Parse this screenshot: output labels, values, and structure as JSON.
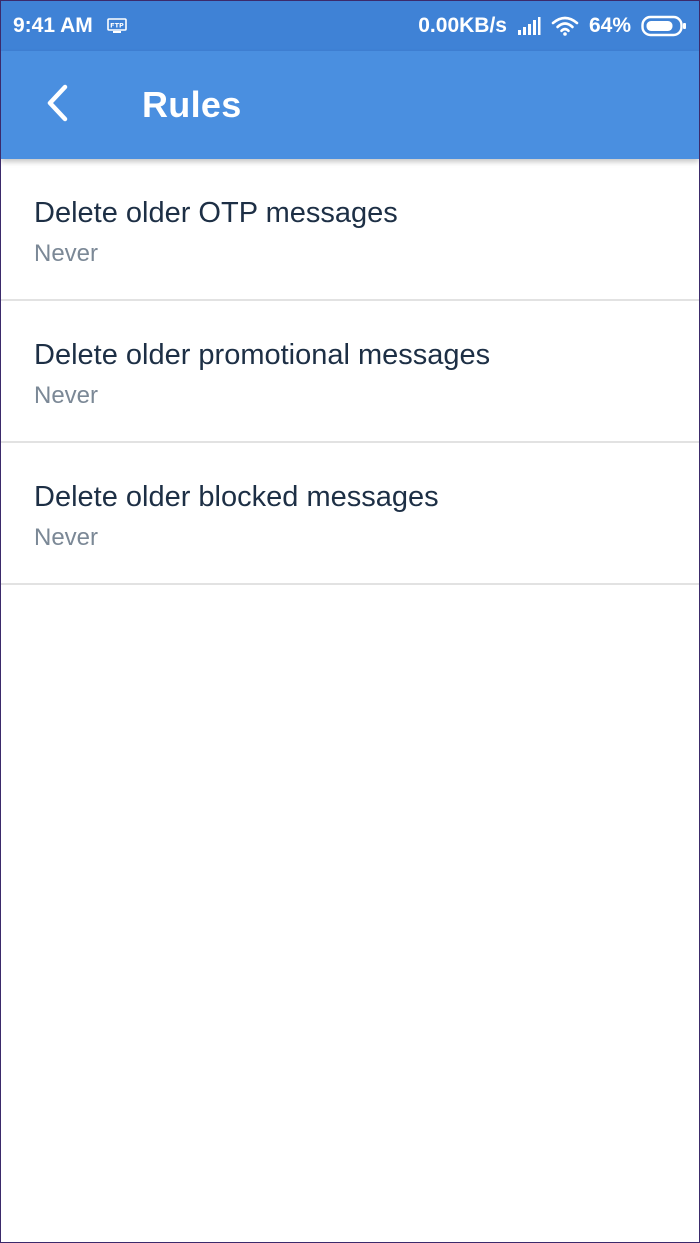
{
  "status_bar": {
    "time": "9:41 AM",
    "network_speed": "0.00KB/s",
    "battery": "64%",
    "icons": [
      "ftp-icon",
      "signal-icon",
      "wifi-icon",
      "battery-icon"
    ]
  },
  "app_bar": {
    "title": "Rules",
    "back_icon": "chevron-left-icon",
    "color": "#4a8fe0"
  },
  "rules": [
    {
      "title": "Delete older OTP messages",
      "value": "Never"
    },
    {
      "title": "Delete older promotional messages",
      "value": "Never"
    },
    {
      "title": "Delete older blocked messages",
      "value": "Never"
    }
  ]
}
